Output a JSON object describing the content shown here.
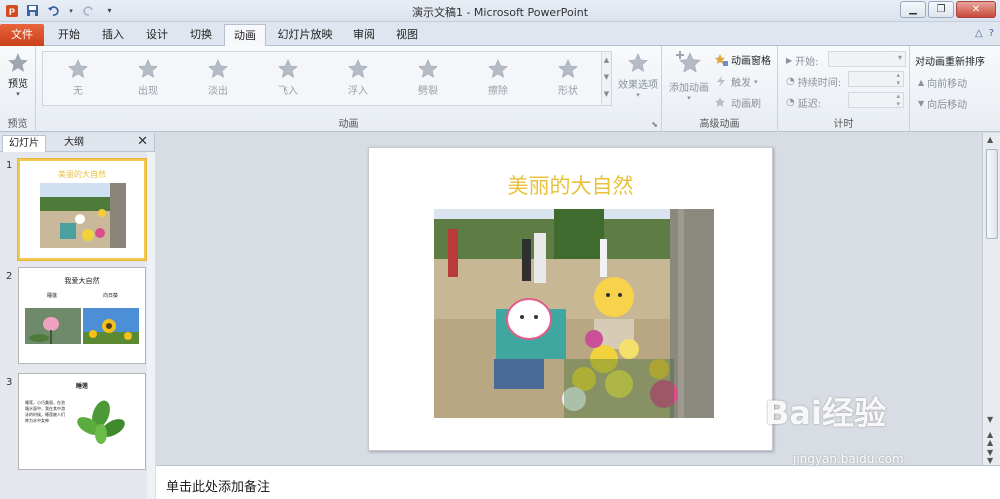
{
  "window": {
    "title": "演示文稿1 - Microsoft PowerPoint",
    "app_icon": "powerpoint-icon"
  },
  "tabs": [
    {
      "label": "文件"
    },
    {
      "label": "开始"
    },
    {
      "label": "插入"
    },
    {
      "label": "设计"
    },
    {
      "label": "切换"
    },
    {
      "label": "动画"
    },
    {
      "label": "幻灯片放映"
    },
    {
      "label": "审阅"
    },
    {
      "label": "视图"
    }
  ],
  "ribbon": {
    "preview": {
      "button": "预览",
      "group": "预览"
    },
    "animation_group": "动画",
    "gallery": [
      "无",
      "出现",
      "淡出",
      "飞入",
      "浮入",
      "劈裂",
      "擦除",
      "形状"
    ],
    "effect_options": "效果选项",
    "advanced": {
      "add_animation": "添加动画",
      "pane": "动画窗格",
      "trigger": "触发",
      "painter": "动画刷",
      "group": "高级动画"
    },
    "timing": {
      "start": "开始:",
      "duration": "持续时间:",
      "delay": "延迟:",
      "group": "计时"
    },
    "reorder": {
      "title": "对动画重新排序",
      "forward": "向前移动",
      "backward": "向后移动"
    }
  },
  "panel": {
    "tab_slides": "幻灯片",
    "tab_outline": "大纲",
    "thumbs": [
      {
        "num": "1",
        "title": "美丽的大自然"
      },
      {
        "num": "2",
        "title": "我爱大自然",
        "left_caption": "睡莲",
        "right_caption": "向日葵"
      },
      {
        "num": "3",
        "title": "睡莲",
        "body": "睡莲，小巧美丽，在池塘水面中，我在其中游泳的时候，睡莲被人们称为水中女神"
      }
    ]
  },
  "slide": {
    "title": "美丽的大自然"
  },
  "notes": {
    "placeholder": "单击此处添加备注"
  },
  "watermark": {
    "brand": "Bai经验",
    "url": "jingyan.baidu.com"
  },
  "colors": {
    "file_tab": "#d24a1e",
    "title_gold": "#e8c23a",
    "selected_border": "#f2c94c"
  }
}
